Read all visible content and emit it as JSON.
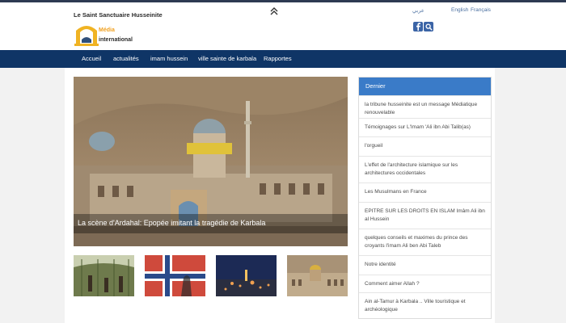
{
  "header": {
    "site_title": "Le Saint Sanctuaire Husseinite",
    "logo_line1": "Média",
    "logo_line2": "international"
  },
  "languages": [
    {
      "label": "عربي"
    },
    {
      "label": "English"
    },
    {
      "label": "Français"
    }
  ],
  "social": {
    "facebook_icon": "facebook-icon",
    "search_icon": "search-icon"
  },
  "nav": {
    "items": [
      {
        "label": "Accueil"
      },
      {
        "label": "actualités"
      },
      {
        "label": "imam hussein"
      },
      {
        "label": "ville sainte de karbala"
      },
      {
        "label": "Rapportes"
      }
    ]
  },
  "hero": {
    "caption": "La scène d'Ardahal: Epopée imitant la tragédie de Karbala"
  },
  "sidebar": {
    "title": "Dernier",
    "items": [
      {
        "label": "la tribune husseinite est un message Médiatique renouvelable"
      },
      {
        "label": "Témoignages sur L'Imam 'Ali ibn Abi Talib(as)"
      },
      {
        "label": "l'orgueil"
      },
      {
        "label": "L'effet de l'architecture islamique sur les architectures occidentales"
      },
      {
        "label": "Les Musulmans en France"
      },
      {
        "label": "EPITRE SUR LES DROITS EN ISLAM Imâm Ali ibn al Hussein"
      },
      {
        "label": "quelques conseils et maximes du prince des croyants l'imam Ali ben Abi Taleb"
      },
      {
        "label": "Notre identité"
      },
      {
        "label": "Comment aimer Allah ?"
      },
      {
        "label": "Ain al-Tamur à Karbala .. Ville touristique et archéologique"
      }
    ]
  },
  "colors": {
    "nav_bg": "#0f3566",
    "sidebar_header": "#3a7bc8",
    "link": "#4a6fa0"
  }
}
